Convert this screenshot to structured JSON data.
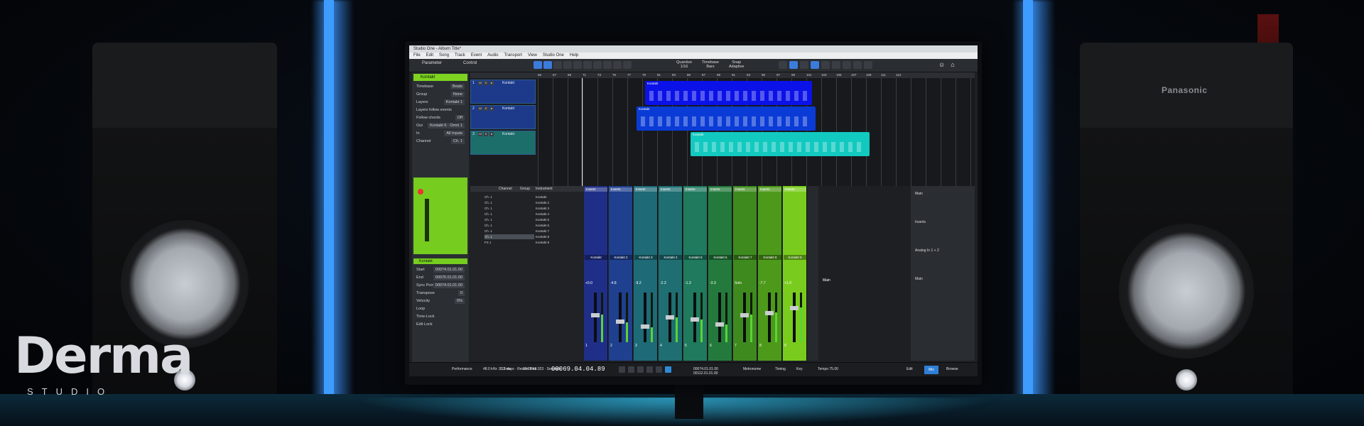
{
  "app": {
    "window_title": "Studio One - Album Title*",
    "menu": [
      "File",
      "Edit",
      "Song",
      "Track",
      "Event",
      "Audio",
      "Transport",
      "View",
      "Studio One",
      "Help"
    ],
    "toolbar_left": [
      "Parameter",
      "Control"
    ],
    "quantize": {
      "label": "Quantize",
      "value": "1/16"
    },
    "timebase": {
      "label": "Timebase",
      "value": "Bars"
    },
    "snap": {
      "label": "Snap",
      "value": "Adaptive"
    }
  },
  "inspector": {
    "track_name": "Kontakt",
    "rows": [
      {
        "k": "Timebase",
        "v": "Beats"
      },
      {
        "k": "Group",
        "v": "None"
      },
      {
        "k": "Layers",
        "v": "Kontakt 1"
      },
      {
        "k": "Layers follow events",
        "v": ""
      },
      {
        "k": "Follow chords",
        "v": "Off"
      },
      {
        "k": "Out",
        "v": "Kontakt 6 · Omni 1"
      },
      {
        "k": "In",
        "v": "All Inputs"
      },
      {
        "k": "Channel",
        "v": "Ch. 1"
      }
    ],
    "section2": "Kontakt",
    "rows2": [
      {
        "k": "Start",
        "v": "00074.01.01.00"
      },
      {
        "k": "End",
        "v": "00076.01.01.00"
      },
      {
        "k": "Sync Point",
        "v": "00074.01.01.00"
      },
      {
        "k": "Transpose",
        "v": "0"
      },
      {
        "k": "Velocity",
        "v": "0%"
      },
      {
        "k": "Loop",
        "v": ""
      },
      {
        "k": "Time-Lock",
        "v": ""
      },
      {
        "k": "Edit Lock",
        "v": ""
      }
    ]
  },
  "arrange": {
    "ruler": [
      "65",
      "67",
      "69",
      "71",
      "73",
      "75",
      "77",
      "79",
      "81",
      "83",
      "85",
      "87",
      "89",
      "91",
      "93",
      "95",
      "97",
      "99",
      "101",
      "103",
      "105",
      "107",
      "109",
      "111",
      "113"
    ],
    "tracks": [
      {
        "num": "1",
        "name": "Kontakt",
        "color": "#1d3a8a"
      },
      {
        "num": "2",
        "name": "Kontakt",
        "color": "#1d3a8a"
      },
      {
        "num": "3",
        "name": "Kontakt",
        "color": "#1c6e6a"
      }
    ],
    "clips": [
      {
        "label": "Kontakt",
        "color": "#0b12e8"
      },
      {
        "label": "Kontakt",
        "color": "#0a3bd6"
      },
      {
        "label": "Kontakt",
        "color": "#12c9c0"
      }
    ]
  },
  "console": {
    "list_header": [
      "Channel",
      "Group",
      "Instrument"
    ],
    "channels": [
      "Ch. 1",
      "Ch. 1",
      "Ch. 1",
      "Ch. 1",
      "Ch. 1",
      "Ch. 1",
      "Ch. 1",
      "Ch. 1",
      "FX 1"
    ],
    "instruments": [
      "Kontakt",
      "Kontakt 2",
      "Kontakt 3",
      "Kontakt 4",
      "Kontakt 5",
      "Kontakt 6",
      "Kontakt 7",
      "Kontakt 8",
      "Kontakt 9"
    ],
    "strips": [
      {
        "name": "Kontakt",
        "vol": "+0.0",
        "num": "1",
        "color": "#1f2f88",
        "level": 0.55
      },
      {
        "name": "Kontakt 2",
        "vol": "-4.8",
        "num": "2",
        "color": "#1f3f8f",
        "level": 0.4
      },
      {
        "name": "Kontakt 3",
        "vol": "-9.2",
        "num": "3",
        "color": "#1e6a77",
        "level": 0.3
      },
      {
        "name": "Kontakt 4",
        "vol": "-2.3",
        "num": "4",
        "color": "#1e6e72",
        "level": 0.5
      },
      {
        "name": "Kontakt 5",
        "vol": "-1.3",
        "num": "5",
        "color": "#1f7a5e",
        "level": 0.45
      },
      {
        "name": "Kontakt 6",
        "vol": "-3.3",
        "num": "6",
        "color": "#247a3c",
        "level": 0.35
      },
      {
        "name": "Kontakt 7",
        "vol": "Solo",
        "num": "7",
        "color": "#3e8a1e",
        "level": 0.55
      },
      {
        "name": "Kontakt 8",
        "vol": "-7.7",
        "num": "8",
        "color": "#4d9a1a",
        "level": 0.6
      },
      {
        "name": "Kontakt 9",
        "vol": "+1.9",
        "num": "9",
        "color": "#79cc1d",
        "level": 0.7
      }
    ],
    "main_label": "Main",
    "out_labels": [
      "Main",
      "Inserts",
      "Analog In 1 + 2",
      "Main"
    ]
  },
  "transport": {
    "items": [
      "Performance",
      "48.0 kHz · 1.3 ms",
      "3:15 days · Record Max",
      "00:02:48.023 · Seconds"
    ],
    "position": "00069.04.04.89",
    "locators": [
      "00074.01.01.00",
      "00112.01.01.00"
    ],
    "right_items": [
      "Metronome",
      "Timing",
      "Key",
      "Tempo 75.00"
    ],
    "mix_button": "Mix",
    "edit_button": "Edit",
    "browse_button": "Browse"
  },
  "branding": {
    "speaker_brand": "Panasonic",
    "logo_text": "Derma",
    "logo_sub": "STUDIO"
  }
}
